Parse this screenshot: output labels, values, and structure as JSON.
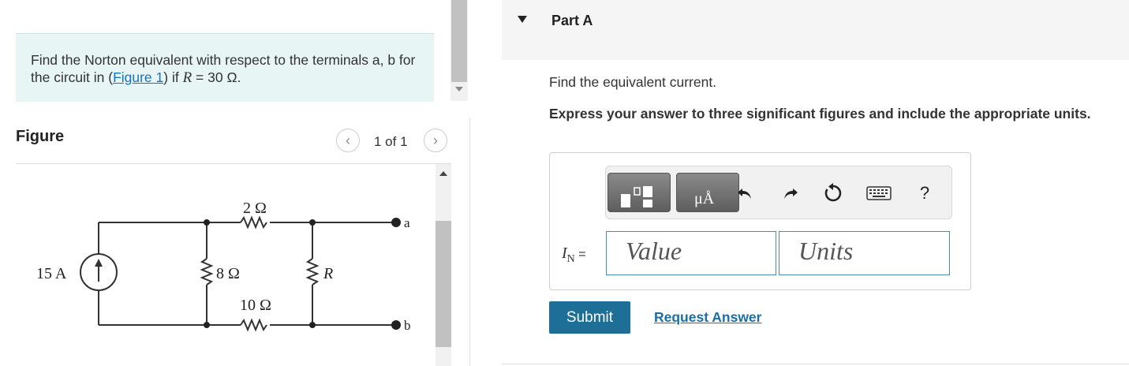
{
  "problem": {
    "text_before": "Find the Norton equivalent with respect to the terminals a, b for the circuit in (",
    "figure_link": "Figure 1",
    "text_after": ") if ",
    "var": "R",
    "value": " = 30 Ω."
  },
  "figure": {
    "title": "Figure",
    "pager": "1 of 1",
    "prev_symbol": "‹",
    "next_symbol": "›",
    "circuit": {
      "source_label": "15 A",
      "r1_label": "2 Ω",
      "r2_label": "8 Ω",
      "r3_label": "10 Ω",
      "r_label": "R",
      "terminal_a": "a",
      "terminal_b": "b"
    }
  },
  "part": {
    "title": "Part A",
    "question": "Find the equivalent current.",
    "instructions": "Express your answer to three significant figures and include the appropriate units."
  },
  "answer": {
    "label_var": "I",
    "label_sub": "N",
    "label_eq": " =",
    "value_placeholder": "Value",
    "units_placeholder": "Units",
    "units_button_glyph": "μÅ",
    "help_glyph": "?"
  },
  "actions": {
    "submit": "Submit",
    "request": "Request Answer"
  },
  "colors": {
    "accent": "#1d6f97",
    "link": "#1a6fa5",
    "prompt_bg": "#e8f5f5"
  }
}
